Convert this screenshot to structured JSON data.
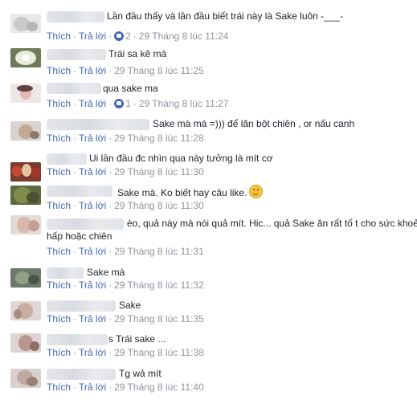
{
  "actions": {
    "like": "Thích",
    "reply": "Trả lời",
    "separator": "·"
  },
  "comments": [
    {
      "text": "Lần đầu thấy và lần đầu biết trái này là Sake luôn -___-",
      "time": "29 Tháng 8 lúc 11:24",
      "likes": "2"
    },
    {
      "text": "Trái sa kê mà",
      "time": "29 Tháng 8 lúc 11:25"
    },
    {
      "text": "qua sake ma",
      "time": "29 Tháng 8 lúc 11:27",
      "likes": "1"
    },
    {
      "text": "Sake mà má =))) để lăn bột chiên , or nấu canh",
      "time": "29 Tháng 8 lúc 11:28"
    },
    {
      "text": "Ui lần đầu đc nhìn qua này tưởng là mít cơ",
      "time": "29 Tháng 8 lúc 11:30"
    },
    {
      "text": "Sake mà. Ko biết hay câu like.",
      "time": "29 Tháng 8 lúc 11:30",
      "emoji": "smile-emoji"
    },
    {
      "text": "èo, quả này mà nói quả mít. Hic... quả Sake ăn rất tố t cho sức khoẻ.",
      "text2": "hấp hoặc chiên",
      "time": "29 Tháng 8 lúc 11:31"
    },
    {
      "text": "Sake mà",
      "time": "29 Tháng 8 lúc 11:32"
    },
    {
      "text": "Sake",
      "time": "29 Tháng 8 lúc 11:35"
    },
    {
      "text": "s Trái sake ...",
      "time": "29 Tháng 8 lúc 11:38"
    },
    {
      "text": "Tg wả mít",
      "time": "29 Tháng 8 lúc 11:40"
    }
  ],
  "colors": {
    "link": "#4267b2",
    "muted": "#90949c",
    "text": "#1d2129"
  }
}
